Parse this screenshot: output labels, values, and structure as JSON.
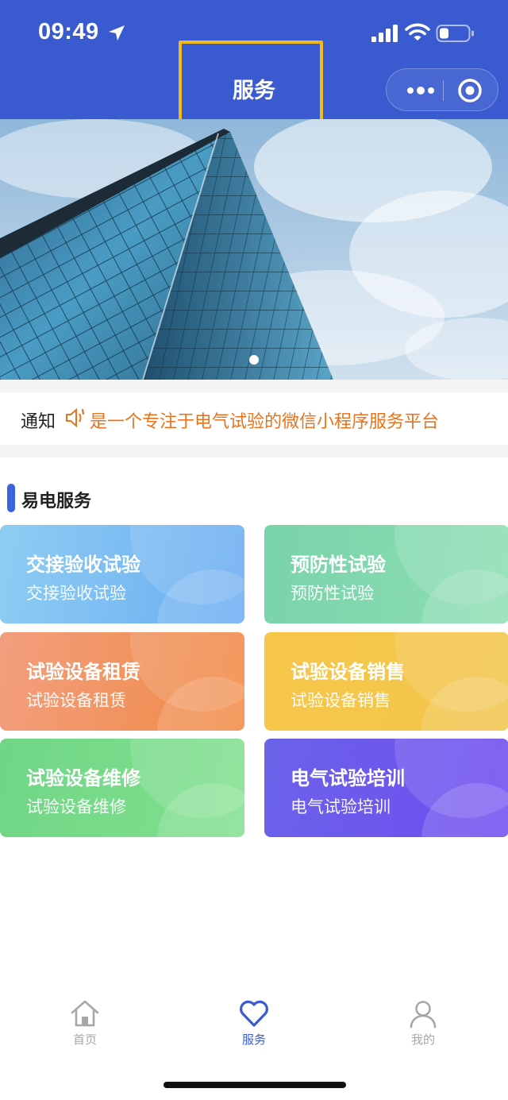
{
  "status_bar": {
    "time": "09:49"
  },
  "header": {
    "title": "服务"
  },
  "notice": {
    "label": "通知",
    "text": "是一个专注于电气试验的微信小程序服务平台"
  },
  "section": {
    "title": "易电服务"
  },
  "services": [
    {
      "title": "交接验收试验",
      "subtitle": "交接验收试验"
    },
    {
      "title": "预防性试验",
      "subtitle": "预防性试验"
    },
    {
      "title": "试验设备租赁",
      "subtitle": "试验设备租赁"
    },
    {
      "title": "试验设备销售",
      "subtitle": "试验设备销售"
    },
    {
      "title": "试验设备维修",
      "subtitle": "试验设备维修"
    },
    {
      "title": "电气试验培训",
      "subtitle": "电气试验培训"
    }
  ],
  "tabbar": {
    "items": [
      {
        "label": "首页",
        "icon": "home-icon",
        "active": false
      },
      {
        "label": "服务",
        "icon": "heart-icon",
        "active": true
      },
      {
        "label": "我的",
        "icon": "user-icon",
        "active": false
      }
    ]
  },
  "colors": {
    "header_bg": "#3a5bd0",
    "notice_text": "#e8731d",
    "active_tab": "#3a5bd0",
    "inactive_tab": "#a7a7a7"
  }
}
